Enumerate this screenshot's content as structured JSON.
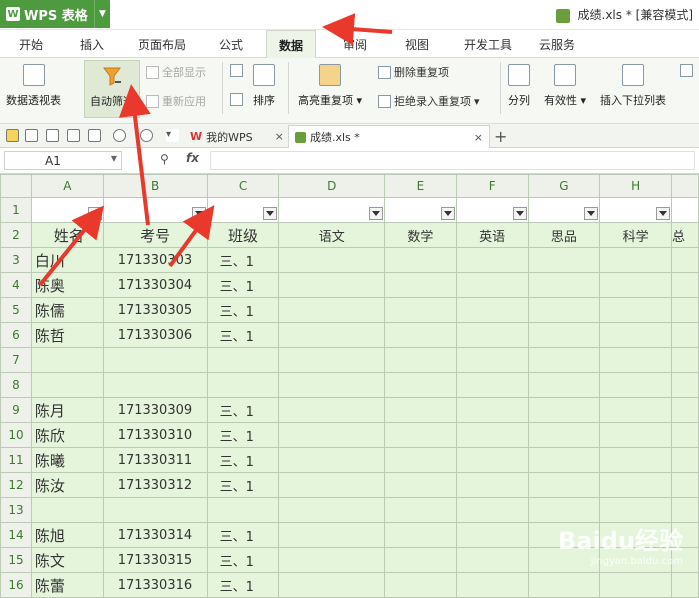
{
  "app": {
    "logo": "W",
    "title": "WPS 表格"
  },
  "doc_title": "成绩.xls * [兼容模式]",
  "tabs": [
    "开始",
    "插入",
    "页面布局",
    "公式",
    "数据",
    "审阅",
    "视图",
    "开发工具",
    "云服务"
  ],
  "active_tab": "数据",
  "ribbon": {
    "pivot": "数据透视表",
    "autofilter": "自动筛选",
    "show_all": "全部显示",
    "reapply": "重新应用",
    "sort": "排序",
    "highlight_dup": "高亮重复项",
    "remove_dup": "删除重复项",
    "reject_dup": "拒绝录入重复项",
    "split": "分列",
    "validity": "有效性",
    "insert_dropdown": "插入下拉列表"
  },
  "doc_tabs": [
    {
      "label": "我的WPS",
      "close": "×"
    },
    {
      "label": "成绩.xls *",
      "close": "×"
    }
  ],
  "new_tab": "+",
  "formula_bar": {
    "cell": "A1",
    "fx": "fx",
    "value": ""
  },
  "columns": [
    "A",
    "B",
    "C",
    "D",
    "E",
    "F",
    "G",
    "H"
  ],
  "headers": [
    "姓名",
    "考号",
    "班级",
    "语文",
    "数学",
    "英语",
    "思品",
    "科学",
    "总"
  ],
  "rows": [
    {
      "n": "1",
      "cells": [
        "",
        "",
        ""
      ]
    },
    {
      "n": "2",
      "cells": [
        "姓名",
        "考号",
        "班级"
      ]
    },
    {
      "n": "3",
      "cells": [
        "白川",
        "171330303",
        "三、1"
      ]
    },
    {
      "n": "4",
      "cells": [
        "陈奥",
        "171330304",
        "三、1"
      ]
    },
    {
      "n": "5",
      "cells": [
        "陈儒",
        "171330305",
        "三、1"
      ]
    },
    {
      "n": "6",
      "cells": [
        "陈哲",
        "171330306",
        "三、1"
      ]
    },
    {
      "n": "7",
      "cells": [
        "",
        "",
        ""
      ]
    },
    {
      "n": "8",
      "cells": [
        "",
        "",
        ""
      ]
    },
    {
      "n": "9",
      "cells": [
        "陈月",
        "171330309",
        "三、1"
      ]
    },
    {
      "n": "10",
      "cells": [
        "陈欣",
        "171330310",
        "三、1"
      ]
    },
    {
      "n": "11",
      "cells": [
        "陈曦",
        "171330311",
        "三、1"
      ]
    },
    {
      "n": "12",
      "cells": [
        "陈汝",
        "171330312",
        "三、1"
      ]
    },
    {
      "n": "13",
      "cells": [
        "",
        "",
        ""
      ]
    },
    {
      "n": "14",
      "cells": [
        "陈旭",
        "171330314",
        "三、1"
      ]
    },
    {
      "n": "15",
      "cells": [
        "陈文",
        "171330315",
        "三、1"
      ]
    },
    {
      "n": "16",
      "cells": [
        "陈蕾",
        "171330316",
        "三、1"
      ]
    }
  ],
  "watermark": "Baidu经验",
  "watermark_url": "jingyan.baidu.com",
  "colors": {
    "brand": "#4e9a3f",
    "cell_fill": "#e5f5dc",
    "arrow": "#e8392c"
  }
}
